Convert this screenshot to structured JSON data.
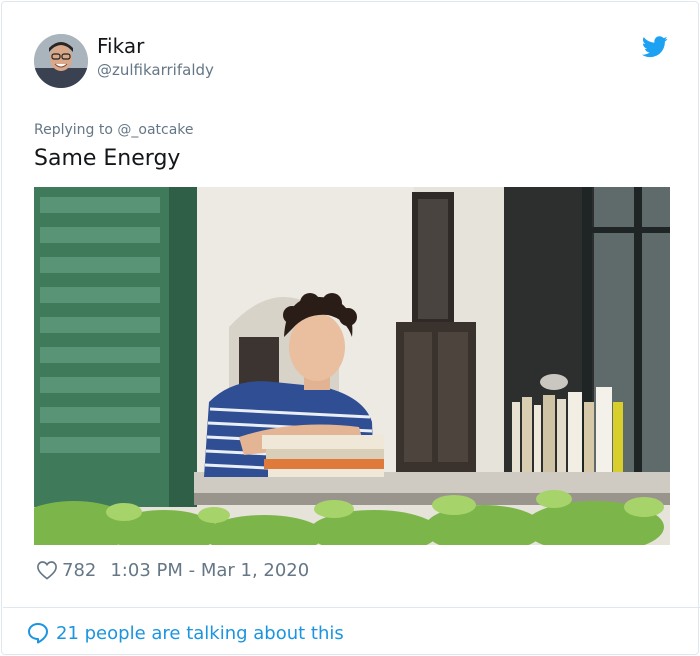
{
  "tweet": {
    "display_name": "Fikar",
    "handle": "@zulfikarrifaldy",
    "reply_to": "Replying to @_oatcake",
    "text": "Same Energy",
    "likes": "782",
    "timestamp": "1:03 PM - Mar 1, 2020",
    "conversation": "21 people are talking about this"
  },
  "icons": {
    "brand": "twitter-bird-icon",
    "like": "heart-icon",
    "reply": "speech-bubble-icon"
  },
  "colors": {
    "twitter_blue": "#1da1f2",
    "link_blue": "#1b95e0",
    "secondary_text": "#657786",
    "border": "#e1e8ed"
  }
}
